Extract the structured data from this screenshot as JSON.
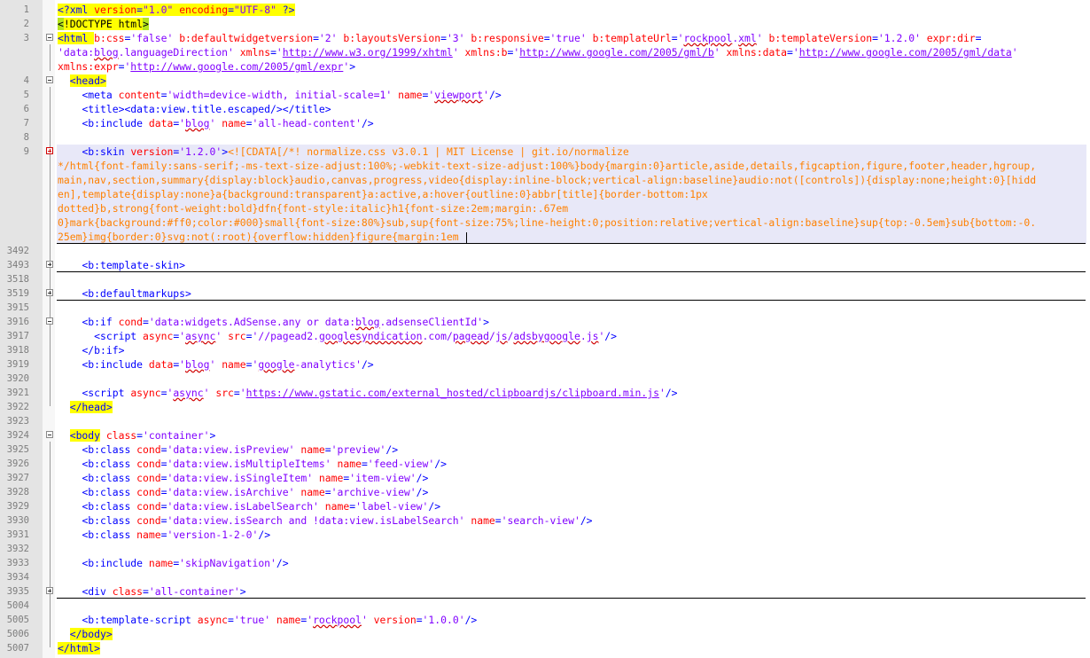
{
  "editor": {
    "lines": [
      {
        "n": "1",
        "t": "<?xml version=\"1.0\" encoding=\"UTF-8\" ?>"
      },
      {
        "n": "2",
        "t": "<!DOCTYPE html>"
      },
      {
        "n": "3",
        "t": "<html b:css='false' b:defaultwidgetversion='2' b:layoutsVersion='3' b:responsive='true' b:templateUrl='rockpool.xml' b:templateVersion='1.2.0' expr:dir='data:blog.languageDirection' xmlns='http://www.w3.org/1999/xhtml' xmlns:b='http://www.google.com/2005/gml/b' xmlns:data='http://www.google.com/2005/gml/data' xmlns:expr='http://www.google.com/2005/gml/expr'>"
      },
      {
        "n": "4",
        "t": "<head>"
      },
      {
        "n": "5",
        "t": "<meta content='width=device-width, initial-scale=1' name='viewport'/>"
      },
      {
        "n": "6",
        "t": "<title><data:view.title.escaped/></title>"
      },
      {
        "n": "7",
        "t": "<b:include data='blog' name='all-head-content'/>"
      },
      {
        "n": "8",
        "t": ""
      },
      {
        "n": "9",
        "t": "<b:skin version='1.2.0'><![CDATA[/*! normalize.css v3.0.1 | MIT License | git.io/normalize */html{font-family:sans-serif;-ms-text-size-adjust:100%;-webkit-text-size-adjust:100%}body{margin:0}article,aside,details,figcaption,figure,footer,header,hgroup,main,nav,section,summary{display:block}audio,canvas,progress,video{display:inline-block;vertical-align:baseline}audio:not([controls]){display:none;height:0}[hidden],template{display:none}a{background:transparent}a:active,a:hover{outline:0}abbr[title]{border-bottom:1px dotted}b,strong{font-weight:bold}dfn{font-style:italic}h1{font-size:2em;margin:.67em 0}mark{background:#ff0;color:#000}small{font-size:80%}sub,sup{font-size:75%;line-height:0;position:relative;vertical-align:baseline}sup{top:-0.5em}sub{bottom:-0.25em}img{border:0}svg:not(:root){overflow:hidden}figure{margin:1em"
      },
      {
        "n": "3492",
        "t": ""
      },
      {
        "n": "3493",
        "t": "<b:template-skin>"
      },
      {
        "n": "3518",
        "t": ""
      },
      {
        "n": "3519",
        "t": "<b:defaultmarkups>"
      },
      {
        "n": "3915",
        "t": ""
      },
      {
        "n": "3916",
        "t": "<b:if cond='data:widgets.AdSense.any or data:blog.adsenseClientId'>"
      },
      {
        "n": "3917",
        "t": "<script async='async' src='//pagead2.googlesyndication.com/pagead/js/adsbygoogle.js'/>"
      },
      {
        "n": "3918",
        "t": "</b:if>"
      },
      {
        "n": "3919",
        "t": "<b:include data='blog' name='google-analytics'/>"
      },
      {
        "n": "3920",
        "t": ""
      },
      {
        "n": "3921",
        "t": "<script async='async' src='https://www.gstatic.com/external_hosted/clipboardjs/clipboard.min.js'/>"
      },
      {
        "n": "3922",
        "t": "</head>"
      },
      {
        "n": "3923",
        "t": ""
      },
      {
        "n": "3924",
        "t": "<body class='container'>"
      },
      {
        "n": "3925",
        "t": "<b:class cond='data:view.isPreview' name='preview'/>"
      },
      {
        "n": "3926",
        "t": "<b:class cond='data:view.isMultipleItems' name='feed-view'/>"
      },
      {
        "n": "3927",
        "t": "<b:class cond='data:view.isSingleItem' name='item-view'/>"
      },
      {
        "n": "3928",
        "t": "<b:class cond='data:view.isArchive' name='archive-view'/>"
      },
      {
        "n": "3929",
        "t": "<b:class cond='data:view.isLabelSearch' name='label-view'/>"
      },
      {
        "n": "3930",
        "t": "<b:class cond='data:view.isSearch and !data:view.isLabelSearch' name='search-view'/>"
      },
      {
        "n": "3931",
        "t": "<b:class name='version-1-2-0'/>"
      },
      {
        "n": "3932",
        "t": ""
      },
      {
        "n": "3933",
        "t": "<b:include name='skipNavigation'/>"
      },
      {
        "n": "3934",
        "t": ""
      },
      {
        "n": "3935",
        "t": "<div class='all-container'>"
      },
      {
        "n": "5004",
        "t": ""
      },
      {
        "n": "5005",
        "t": "<b:template-script async='true' name='rockpool' version='1.0.0'/>"
      },
      {
        "n": "5006",
        "t": "</body>"
      },
      {
        "n": "5007",
        "t": "</html>"
      }
    ],
    "colors": {
      "highlight": "#ffff00",
      "highlight_green": "#b5e61d",
      "tag": "#0000ff",
      "attribute": "#ff0000",
      "value": "#8000ff",
      "cdata": "#ff8000",
      "selection": "#e8e8f8",
      "gutter": "#e4e4e4"
    },
    "icons": {
      "fold_open": "minus-box-icon",
      "fold_closed": "plus-box-icon"
    }
  }
}
